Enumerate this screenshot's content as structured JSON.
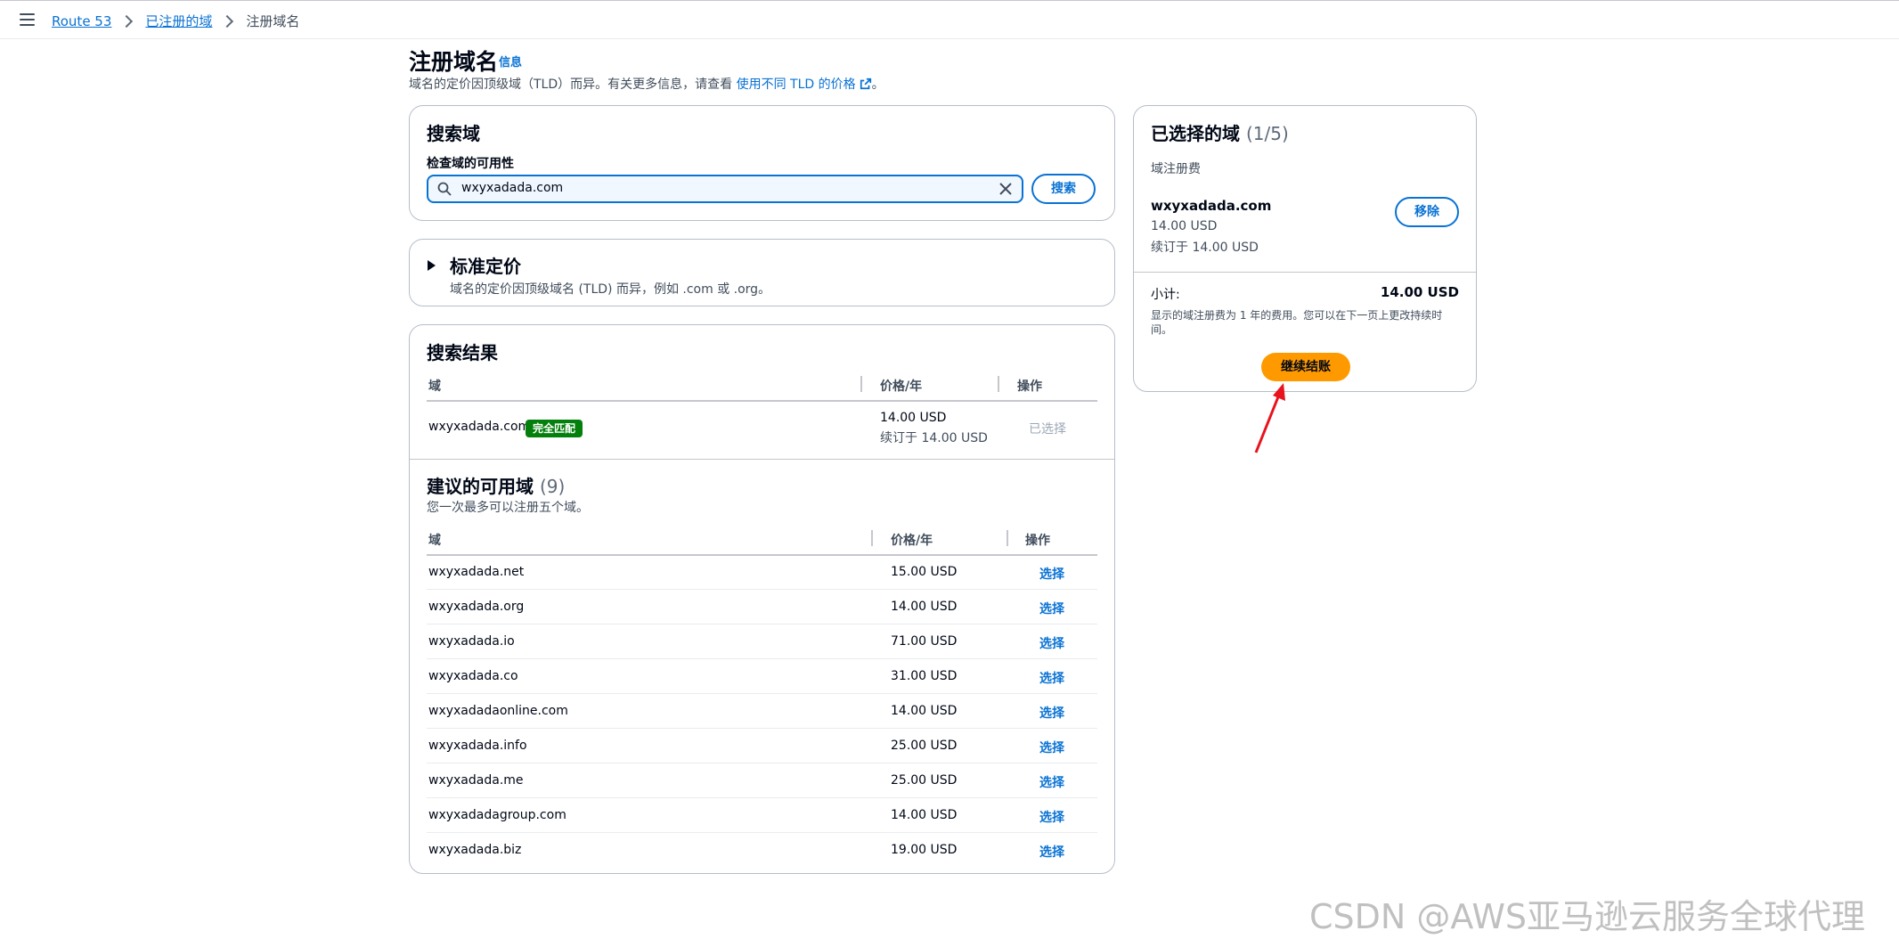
{
  "breadcrumb": {
    "items": [
      "Route 53",
      "已注册的域",
      "注册域名"
    ]
  },
  "page": {
    "title": "注册域名",
    "info": "信息",
    "desc_prefix": "域名的定价因顶级域（TLD）而异。有关更多信息，请查看",
    "desc_link": "使用不同 TLD 的价格",
    "desc_suffix": "。"
  },
  "search": {
    "title": "搜索域",
    "label": "检查域的可用性",
    "value": "wxyxadada.com",
    "button": "搜索"
  },
  "pricing": {
    "title": "标准定价",
    "desc": "域名的定价因顶级域名 (TLD) 而异，例如 .com 或 .org。"
  },
  "results": {
    "title": "搜索结果",
    "headers": [
      "域",
      "价格/年",
      "操作"
    ],
    "row": {
      "domain": "wxyxadada.com",
      "badge": "完全匹配",
      "price": "14.00 USD",
      "renew": "续订于 14.00 USD",
      "action": "已选择"
    }
  },
  "suggestions": {
    "title": "建议的可用域",
    "count": "(9)",
    "subtitle": "您一次最多可以注册五个域。",
    "headers": [
      "域",
      "价格/年",
      "操作"
    ],
    "rows": [
      {
        "domain": "wxyxadada.net",
        "price": "15.00 USD",
        "action": "选择"
      },
      {
        "domain": "wxyxadada.org",
        "price": "14.00 USD",
        "action": "选择"
      },
      {
        "domain": "wxyxadada.io",
        "price": "71.00 USD",
        "action": "选择"
      },
      {
        "domain": "wxyxadada.co",
        "price": "31.00 USD",
        "action": "选择"
      },
      {
        "domain": "wxyxadadaonline.com",
        "price": "14.00 USD",
        "action": "选择"
      },
      {
        "domain": "wxyxadada.info",
        "price": "25.00 USD",
        "action": "选择"
      },
      {
        "domain": "wxyxadada.me",
        "price": "25.00 USD",
        "action": "选择"
      },
      {
        "domain": "wxyxadadagroup.com",
        "price": "14.00 USD",
        "action": "选择"
      },
      {
        "domain": "wxyxadada.biz",
        "price": "19.00 USD",
        "action": "选择"
      }
    ]
  },
  "selected": {
    "title": "已选择的域",
    "count": "(1/5)",
    "fee_label": "域注册费",
    "domain": "wxyxadada.com",
    "price": "14.00 USD",
    "renew": "续订于 14.00 USD",
    "remove": "移除",
    "subtotal_label": "小计:",
    "subtotal": "14.00 USD",
    "note": "显示的域注册费为 1 年的费用。您可以在下一页上更改持续时间。",
    "checkout": "继续结账"
  },
  "watermark": "CSDN @AWS亚马逊云服务全球代理",
  "colors": {
    "link": "#0972d3",
    "accent_orange": "#ff9900",
    "badge_green": "#037f0c",
    "annotation_red": "#e8131c"
  }
}
